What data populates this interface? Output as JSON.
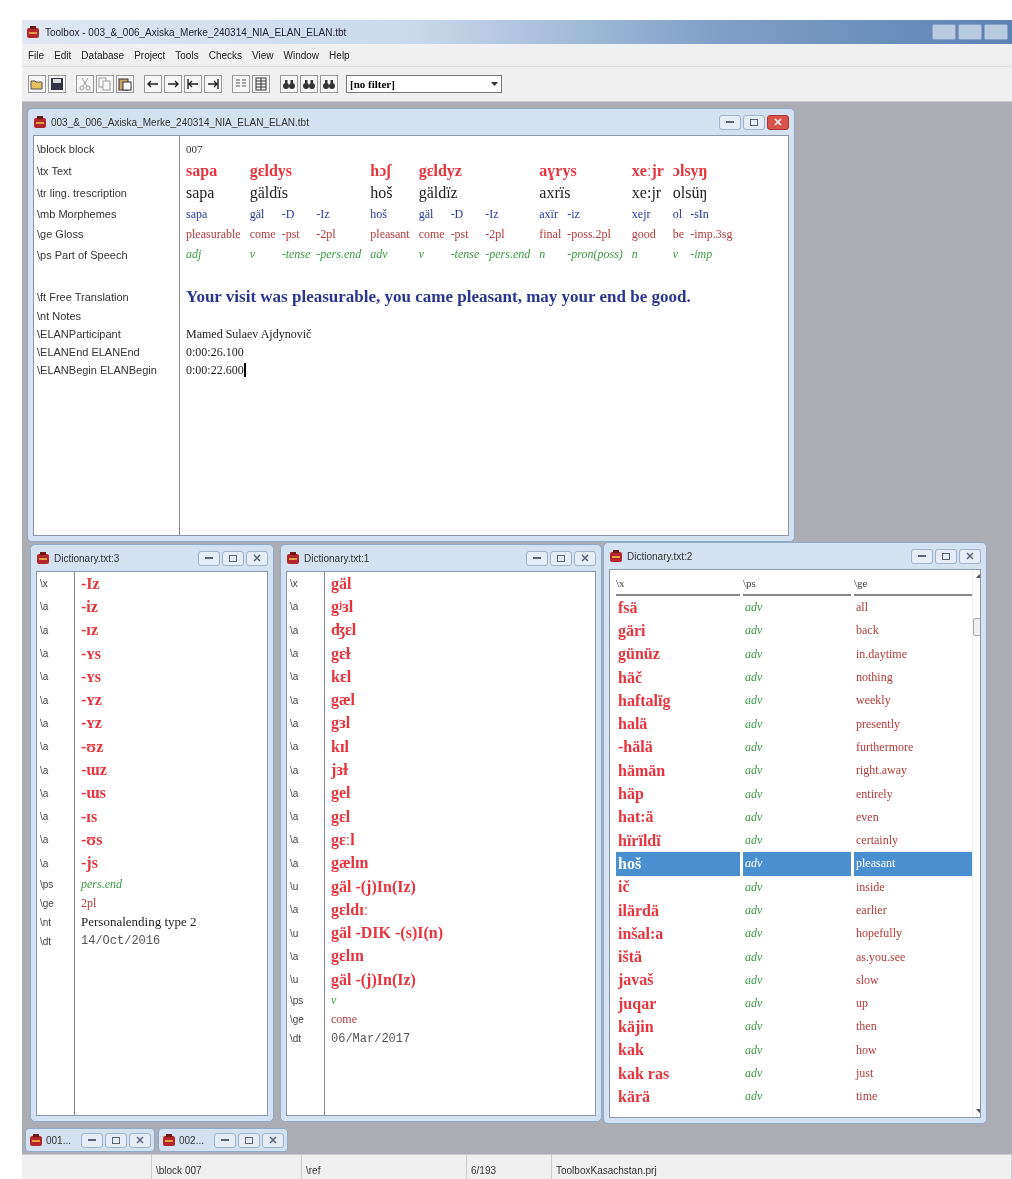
{
  "app": {
    "title": "Toolbox - 003_&_006_Axiska_Merke_240314_NIA_ELAN_ELAN.tbt"
  },
  "menu": [
    "File",
    "Edit",
    "Database",
    "Project",
    "Tools",
    "Checks",
    "View",
    "Window",
    "Help"
  ],
  "filter": {
    "value": "[no filter]"
  },
  "record_window": {
    "title": "003_&_006_Axiska_Merke_240314_NIA_ELAN_ELAN.tbt",
    "field_labels": [
      "\\block block",
      "\\tx Text",
      "\\tr ling. trescription",
      "\\mb Morphemes",
      "\\ge Gloss",
      "\\ps Part of Speech",
      "\\ft Free Translation",
      "\\nt Notes",
      "\\ELANParticipant",
      "\\ELANEnd ELANEnd",
      "\\ELANBegin ELANBegin"
    ],
    "block": "007",
    "interlinear": [
      {
        "text": "sapa",
        "transcription": "sapa",
        "morphemes": [
          {
            "form": "sapa",
            "gloss": "pleasurable",
            "pos": "adj"
          }
        ]
      },
      {
        "text": "gɛldys",
        "transcription": "gäldïs",
        "morphemes": [
          {
            "form": "gäl",
            "gloss": "come",
            "pos": "v"
          },
          {
            "form": "-D",
            "gloss": "-pst",
            "pos": "-tense"
          },
          {
            "form": "-Iz",
            "gloss": "-2pl",
            "pos": "-pers.end"
          }
        ]
      },
      {
        "text": "hɔʃ",
        "transcription": "hoš",
        "morphemes": [
          {
            "form": "hoš",
            "gloss": "pleasant",
            "pos": "adv"
          }
        ]
      },
      {
        "text": "gɛldyz",
        "transcription": "gäldïz",
        "morphemes": [
          {
            "form": "gäl",
            "gloss": "come",
            "pos": "v"
          },
          {
            "form": "-D",
            "gloss": "-pst",
            "pos": "-tense"
          },
          {
            "form": "-Iz",
            "gloss": "-2pl",
            "pos": "-pers.end"
          }
        ]
      },
      {
        "text": "aɣrys",
        "transcription": "axrïs",
        "morphemes": [
          {
            "form": "axïr",
            "gloss": "final",
            "pos": "n"
          },
          {
            "form": "-iz",
            "gloss": "-poss.2pl",
            "pos": "-pron(poss)"
          }
        ]
      },
      {
        "text": "xeːjr",
        "transcription": "xe:jr",
        "morphemes": [
          {
            "form": "xejr",
            "gloss": "good",
            "pos": "n"
          }
        ]
      },
      {
        "text": "ɔlsyŋ",
        "transcription": "olsüŋ",
        "morphemes": [
          {
            "form": "ol",
            "gloss": "be",
            "pos": "v"
          },
          {
            "form": "-sIn",
            "gloss": "-imp.3sg",
            "pos": "-imp"
          }
        ]
      }
    ],
    "free_translation": "Your visit was pleasurable, you came pleasant, may your end be good.",
    "participant": "Mamed Sulaev Ajdynovič",
    "elan_end": "0:00:26.100",
    "elan_begin": "0:00:22.600"
  },
  "dict_left": {
    "title": "Dictionary.txt:3",
    "fields": [
      {
        "marker": "\\x",
        "value": "-Iz",
        "kind": "headword"
      },
      {
        "marker": "\\a",
        "value": "-iz",
        "kind": "headword"
      },
      {
        "marker": "\\a",
        "value": "-ɪz",
        "kind": "headword"
      },
      {
        "marker": "\\a",
        "value": "-ʏs",
        "kind": "headword"
      },
      {
        "marker": "\\a",
        "value": "-ʏs",
        "kind": "headword"
      },
      {
        "marker": "\\a",
        "value": "-ʏz",
        "kind": "headword"
      },
      {
        "marker": "\\a",
        "value": "-ʏz",
        "kind": "headword"
      },
      {
        "marker": "\\a",
        "value": "-ʊz",
        "kind": "headword"
      },
      {
        "marker": "\\a",
        "value": "-ɯz",
        "kind": "headword"
      },
      {
        "marker": "\\a",
        "value": "-ɯs",
        "kind": "headword"
      },
      {
        "marker": "\\a",
        "value": "-ɪs",
        "kind": "headword"
      },
      {
        "marker": "\\a",
        "value": "-ʊs",
        "kind": "headword"
      },
      {
        "marker": "\\a",
        "value": "-js",
        "kind": "headword"
      },
      {
        "marker": "\\ps",
        "value": "pers.end",
        "kind": "pos"
      },
      {
        "marker": "\\ge",
        "value": "2pl",
        "kind": "gloss"
      },
      {
        "marker": "\\nt",
        "value": "Personalending type 2",
        "kind": "note"
      },
      {
        "marker": "\\dt",
        "value": "14/Oct/2016",
        "kind": "date"
      }
    ]
  },
  "dict_middle": {
    "title": "Dictionary.txt:1",
    "fields": [
      {
        "marker": "\\x",
        "value": "gäl",
        "kind": "headword"
      },
      {
        "marker": "\\a",
        "value": "gʲɜl",
        "kind": "headword"
      },
      {
        "marker": "\\a",
        "value": "ʤɛl",
        "kind": "headword"
      },
      {
        "marker": "\\a",
        "value": "gɛɫ",
        "kind": "headword"
      },
      {
        "marker": "\\a",
        "value": "kɛl",
        "kind": "headword"
      },
      {
        "marker": "\\a",
        "value": "gæl",
        "kind": "headword"
      },
      {
        "marker": "\\a",
        "value": "gɜl",
        "kind": "headword"
      },
      {
        "marker": "\\a",
        "value": "kɪl",
        "kind": "headword"
      },
      {
        "marker": "\\a",
        "value": "jɜɫ",
        "kind": "headword"
      },
      {
        "marker": "\\a",
        "value": "gel",
        "kind": "headword"
      },
      {
        "marker": "\\a",
        "value": "gɛl",
        "kind": "headword"
      },
      {
        "marker": "\\a",
        "value": "gɛːl",
        "kind": "headword"
      },
      {
        "marker": "\\a",
        "value": "gælɪn",
        "kind": "headword"
      },
      {
        "marker": "\\u",
        "value": "gäl -(j)In(Iz)",
        "kind": "headword"
      },
      {
        "marker": "\\a",
        "value": "gɛldɪː",
        "kind": "headword"
      },
      {
        "marker": "\\u",
        "value": "gäl -DIK -(s)I(n)",
        "kind": "headword"
      },
      {
        "marker": "\\a",
        "value": "gɛlɪn",
        "kind": "headword"
      },
      {
        "marker": "\\u",
        "value": "gäl -(j)In(Iz)",
        "kind": "headword"
      },
      {
        "marker": "\\ps",
        "value": "v",
        "kind": "pos"
      },
      {
        "marker": "\\ge",
        "value": "come",
        "kind": "gloss"
      },
      {
        "marker": "\\dt",
        "value": "06/Mar/2017",
        "kind": "date"
      }
    ]
  },
  "dict_right": {
    "title": "Dictionary.txt:2",
    "columns": [
      "\\x",
      "\\ps",
      "\\ge"
    ],
    "rows": [
      {
        "x": "fsä",
        "ps": "adv",
        "ge": "all",
        "selected": false
      },
      {
        "x": "gäri",
        "ps": "adv",
        "ge": "back",
        "selected": false
      },
      {
        "x": "günüz",
        "ps": "adv",
        "ge": "in.daytime",
        "selected": false
      },
      {
        "x": "häč",
        "ps": "adv",
        "ge": "nothing",
        "selected": false
      },
      {
        "x": "haftalïg",
        "ps": "adv",
        "ge": "weekly",
        "selected": false
      },
      {
        "x": "halä",
        "ps": "adv",
        "ge": "presently",
        "selected": false
      },
      {
        "x": "-hälä",
        "ps": "adv",
        "ge": "furthermore",
        "selected": false
      },
      {
        "x": "hämän",
        "ps": "adv",
        "ge": "right.away",
        "selected": false
      },
      {
        "x": "häp",
        "ps": "adv",
        "ge": "entirely",
        "selected": false
      },
      {
        "x": "hat:ä",
        "ps": "adv",
        "ge": "even",
        "selected": false
      },
      {
        "x": "hïrïldï",
        "ps": "adv",
        "ge": "certainly",
        "selected": false
      },
      {
        "x": "hoš",
        "ps": "adv",
        "ge": "pleasant",
        "selected": true
      },
      {
        "x": "ič",
        "ps": "adv",
        "ge": "inside",
        "selected": false
      },
      {
        "x": "ilärdä",
        "ps": "adv",
        "ge": "earlier",
        "selected": false
      },
      {
        "x": "inšal:a",
        "ps": "adv",
        "ge": "hopefully",
        "selected": false
      },
      {
        "x": "ištä",
        "ps": "adv",
        "ge": "as.you.see",
        "selected": false
      },
      {
        "x": "javaš",
        "ps": "adv",
        "ge": "slow",
        "selected": false
      },
      {
        "x": "juqar",
        "ps": "adv",
        "ge": "up",
        "selected": false
      },
      {
        "x": "käjin",
        "ps": "adv",
        "ge": "then",
        "selected": false
      },
      {
        "x": "kak",
        "ps": "adv",
        "ge": "how",
        "selected": false
      },
      {
        "x": "kak ras",
        "ps": "adv",
        "ge": "just",
        "selected": false
      },
      {
        "x": "kärä",
        "ps": "adv",
        "ge": "time",
        "selected": false
      }
    ]
  },
  "minimized_windows": [
    {
      "label": "001..."
    },
    {
      "label": "002..."
    }
  ],
  "status_bar": [
    "\\block 007",
    "\\ref",
    "6/193",
    "ToolboxKasachstan.prj"
  ]
}
